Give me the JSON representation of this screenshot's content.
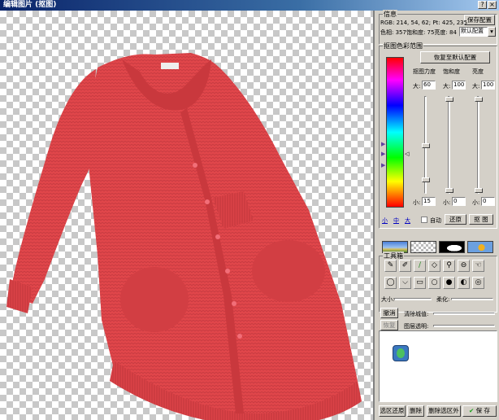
{
  "window": {
    "title": "编辑图片 (抠图)",
    "help_btn": "?",
    "close_btn": "×"
  },
  "info": {
    "label": "信息",
    "rgb_line": "RGB: 214, 54, 62; Pt: 425, 235",
    "hsl_line": "色相: 357饱和度: 75亮度: 84",
    "save_config": "保存配置",
    "config_select": "默认配置"
  },
  "color_range": {
    "label": "抠图色彩范围",
    "restore_default": "恢复至默认配置",
    "col1": {
      "header": "抠图力度",
      "big_label": "大:",
      "big_value": "60",
      "small_label": "小:",
      "small_value": "15"
    },
    "col2": {
      "header": "饱和度",
      "big_label": "大:",
      "big_value": "100",
      "small_label": "小:",
      "small_value": "0"
    },
    "col3": {
      "header": "亮度",
      "big_label": "大:",
      "big_value": "100",
      "small_label": "小:",
      "small_value": "0"
    },
    "size_small": "小",
    "size_medium": "中",
    "size_large": "大",
    "auto_label": "自动",
    "restore_btn": "还原",
    "cut_btn": "抠 图"
  },
  "toolbox": {
    "label": "工具箱",
    "size_label": "大小:",
    "soft_label": "柔化:"
  },
  "history": {
    "undo": "撤消",
    "redo": "恢复",
    "clear_area": "清除城值:",
    "layer_opacity": "图层透明:"
  },
  "footer": {
    "restore_region": "选区还原",
    "delete": "删除",
    "delete_outside": "删除选区外",
    "save": "保 存"
  },
  "colors": {
    "accent": "#0a246a",
    "garment": "#e0464a",
    "panel": "#d4d0c8"
  }
}
